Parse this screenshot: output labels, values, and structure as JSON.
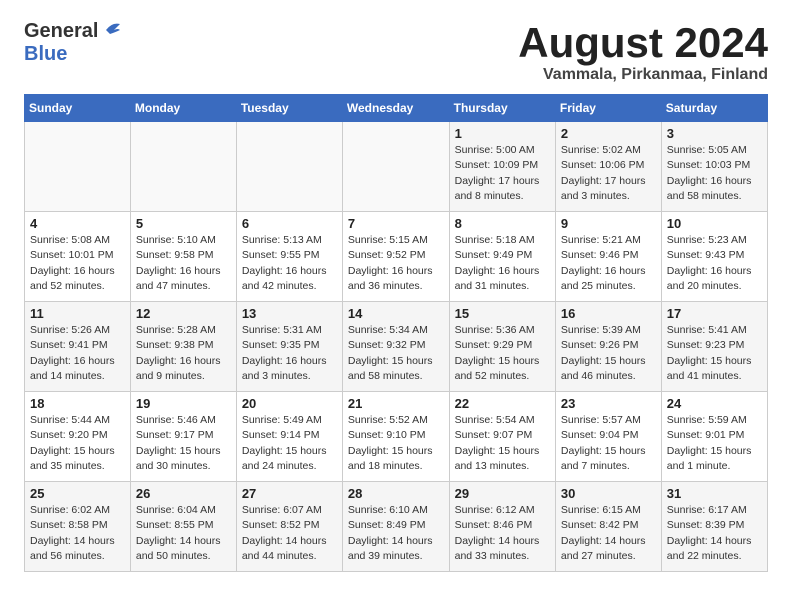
{
  "header": {
    "logo_general": "General",
    "logo_blue": "Blue",
    "month_title": "August 2024",
    "location": "Vammala, Pirkanmaa, Finland"
  },
  "weekdays": [
    "Sunday",
    "Monday",
    "Tuesday",
    "Wednesday",
    "Thursday",
    "Friday",
    "Saturday"
  ],
  "weeks": [
    [
      {
        "day": "",
        "info": ""
      },
      {
        "day": "",
        "info": ""
      },
      {
        "day": "",
        "info": ""
      },
      {
        "day": "",
        "info": ""
      },
      {
        "day": "1",
        "info": "Sunrise: 5:00 AM\nSunset: 10:09 PM\nDaylight: 17 hours\nand 8 minutes."
      },
      {
        "day": "2",
        "info": "Sunrise: 5:02 AM\nSunset: 10:06 PM\nDaylight: 17 hours\nand 3 minutes."
      },
      {
        "day": "3",
        "info": "Sunrise: 5:05 AM\nSunset: 10:03 PM\nDaylight: 16 hours\nand 58 minutes."
      }
    ],
    [
      {
        "day": "4",
        "info": "Sunrise: 5:08 AM\nSunset: 10:01 PM\nDaylight: 16 hours\nand 52 minutes."
      },
      {
        "day": "5",
        "info": "Sunrise: 5:10 AM\nSunset: 9:58 PM\nDaylight: 16 hours\nand 47 minutes."
      },
      {
        "day": "6",
        "info": "Sunrise: 5:13 AM\nSunset: 9:55 PM\nDaylight: 16 hours\nand 42 minutes."
      },
      {
        "day": "7",
        "info": "Sunrise: 5:15 AM\nSunset: 9:52 PM\nDaylight: 16 hours\nand 36 minutes."
      },
      {
        "day": "8",
        "info": "Sunrise: 5:18 AM\nSunset: 9:49 PM\nDaylight: 16 hours\nand 31 minutes."
      },
      {
        "day": "9",
        "info": "Sunrise: 5:21 AM\nSunset: 9:46 PM\nDaylight: 16 hours\nand 25 minutes."
      },
      {
        "day": "10",
        "info": "Sunrise: 5:23 AM\nSunset: 9:43 PM\nDaylight: 16 hours\nand 20 minutes."
      }
    ],
    [
      {
        "day": "11",
        "info": "Sunrise: 5:26 AM\nSunset: 9:41 PM\nDaylight: 16 hours\nand 14 minutes."
      },
      {
        "day": "12",
        "info": "Sunrise: 5:28 AM\nSunset: 9:38 PM\nDaylight: 16 hours\nand 9 minutes."
      },
      {
        "day": "13",
        "info": "Sunrise: 5:31 AM\nSunset: 9:35 PM\nDaylight: 16 hours\nand 3 minutes."
      },
      {
        "day": "14",
        "info": "Sunrise: 5:34 AM\nSunset: 9:32 PM\nDaylight: 15 hours\nand 58 minutes."
      },
      {
        "day": "15",
        "info": "Sunrise: 5:36 AM\nSunset: 9:29 PM\nDaylight: 15 hours\nand 52 minutes."
      },
      {
        "day": "16",
        "info": "Sunrise: 5:39 AM\nSunset: 9:26 PM\nDaylight: 15 hours\nand 46 minutes."
      },
      {
        "day": "17",
        "info": "Sunrise: 5:41 AM\nSunset: 9:23 PM\nDaylight: 15 hours\nand 41 minutes."
      }
    ],
    [
      {
        "day": "18",
        "info": "Sunrise: 5:44 AM\nSunset: 9:20 PM\nDaylight: 15 hours\nand 35 minutes."
      },
      {
        "day": "19",
        "info": "Sunrise: 5:46 AM\nSunset: 9:17 PM\nDaylight: 15 hours\nand 30 minutes."
      },
      {
        "day": "20",
        "info": "Sunrise: 5:49 AM\nSunset: 9:14 PM\nDaylight: 15 hours\nand 24 minutes."
      },
      {
        "day": "21",
        "info": "Sunrise: 5:52 AM\nSunset: 9:10 PM\nDaylight: 15 hours\nand 18 minutes."
      },
      {
        "day": "22",
        "info": "Sunrise: 5:54 AM\nSunset: 9:07 PM\nDaylight: 15 hours\nand 13 minutes."
      },
      {
        "day": "23",
        "info": "Sunrise: 5:57 AM\nSunset: 9:04 PM\nDaylight: 15 hours\nand 7 minutes."
      },
      {
        "day": "24",
        "info": "Sunrise: 5:59 AM\nSunset: 9:01 PM\nDaylight: 15 hours\nand 1 minute."
      }
    ],
    [
      {
        "day": "25",
        "info": "Sunrise: 6:02 AM\nSunset: 8:58 PM\nDaylight: 14 hours\nand 56 minutes."
      },
      {
        "day": "26",
        "info": "Sunrise: 6:04 AM\nSunset: 8:55 PM\nDaylight: 14 hours\nand 50 minutes."
      },
      {
        "day": "27",
        "info": "Sunrise: 6:07 AM\nSunset: 8:52 PM\nDaylight: 14 hours\nand 44 minutes."
      },
      {
        "day": "28",
        "info": "Sunrise: 6:10 AM\nSunset: 8:49 PM\nDaylight: 14 hours\nand 39 minutes."
      },
      {
        "day": "29",
        "info": "Sunrise: 6:12 AM\nSunset: 8:46 PM\nDaylight: 14 hours\nand 33 minutes."
      },
      {
        "day": "30",
        "info": "Sunrise: 6:15 AM\nSunset: 8:42 PM\nDaylight: 14 hours\nand 27 minutes."
      },
      {
        "day": "31",
        "info": "Sunrise: 6:17 AM\nSunset: 8:39 PM\nDaylight: 14 hours\nand 22 minutes."
      }
    ]
  ]
}
